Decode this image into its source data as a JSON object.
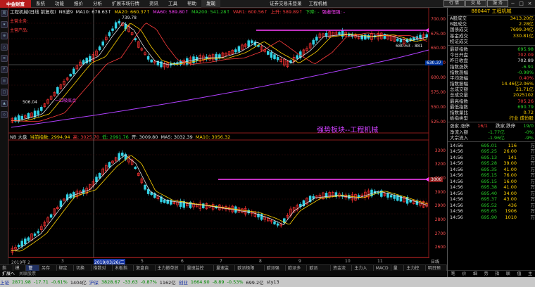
{
  "menubar": {
    "logo": "中金财富",
    "items": [
      "系统",
      "功能",
      "报价",
      "分析",
      "扩展市场行情",
      "资讯",
      "工具",
      "帮助",
      "发现"
    ],
    "active_index": 8,
    "center_items": [
      "证券交易未登录",
      "工程机械"
    ],
    "buttons": [
      "行 情",
      "交 易",
      "服 务"
    ],
    "win_symbols": [
      "−",
      "□",
      "×"
    ]
  },
  "left_tools": [
    "周",
    "★",
    "⊕",
    "△",
    "≡",
    "F",
    "◎",
    "□",
    "▲",
    "◇"
  ],
  "upper_chart": {
    "legend": [
      {
        "text": "工程机械(日线 前复权)",
        "color": "#e0e0e0"
      },
      {
        "text": "NB波9",
        "color": "#e0e0e0"
      },
      {
        "text": "MA10: 678.63↑",
        "color": "#e0e0e0"
      },
      {
        "text": "MA20: 660.37↑",
        "color": "#ffd200"
      },
      {
        "text": "MA60: 589.80↑",
        "color": "#ff40ff"
      },
      {
        "text": "MA200: 541.28↑",
        "color": "#28d028"
      },
      {
        "text": "VAR1: 600.56↑",
        "color": "#ff3c3c"
      },
      {
        "text": "上升: 589.89↑",
        "color": "#ff3c3c"
      },
      {
        "text": "下降: -",
        "color": "#28d028"
      },
      {
        "text": "强者恒强: -",
        "color": "#ff40ff"
      }
    ],
    "tag_main_business": "主营业务:",
    "tag_main_product": "主营产品:",
    "peak_label": "739.78",
    "low_label": "506.04",
    "entry_label": "一口吸底点",
    "right_range_label": "680.63 - 881",
    "strong_label": "强势板块--工程机械",
    "cursor_price": "630.37",
    "price_axis": [
      "700.00",
      "675.00",
      "650.00",
      "625.00",
      "600.00",
      "575.00",
      "550.00",
      "525.00"
    ]
  },
  "lower_chart": {
    "legend": [
      {
        "text": "NB 大盘",
        "color": "#e0e0e0"
      },
      {
        "text": "当前指数: 2994.94",
        "color": "#ffd200"
      },
      {
        "text": "高: 3025.70",
        "color": "#ff3c3c"
      },
      {
        "text": "低: 2991.76",
        "color": "#28d028"
      },
      {
        "text": "开: 3009.80",
        "color": "#e0e0e0"
      },
      {
        "text": "MA5: 3032.39",
        "color": "#e0e0e0"
      },
      {
        "text": "MA10: 3056.32",
        "color": "#ffd200"
      }
    ],
    "price_axis": [
      "3300",
      "3200",
      "3100",
      "3000",
      "2900",
      "2800",
      "2700",
      "2600"
    ],
    "cursor_price": "3000"
  },
  "date_axis": {
    "labels": [
      "2019年 2",
      "3",
      "2019/03/26/二",
      "5",
      "6",
      "7",
      "8",
      "9",
      "10",
      "11"
    ],
    "highlight_index": 2,
    "right_label": "日线"
  },
  "bottom_tabs": {
    "items": [
      "指标",
      "模板",
      "管理",
      "另存为",
      "绑定到",
      "切换到",
      "指数对比",
      "木板指标",
      "复盘自动",
      "主力撤单放量",
      "量速监控610",
      "量速监控",
      "欧派极限410",
      "欧派强势",
      "欧派多空",
      "欧派2503",
      "资金流向",
      "主力入场",
      "MACD",
      "量能",
      "主力控盘",
      "明日预测"
    ],
    "active_index": 2
  },
  "sub_tabs": {
    "items": [
      "扩展へ",
      "关联股票"
    ],
    "active_index": 0
  },
  "statusbar": {
    "items": [
      {
        "text": "上证",
        "cls": "st-blue"
      },
      {
        "text": "2871.98",
        "cls": "st-green"
      },
      {
        "text": "-17.71",
        "cls": "st-green"
      },
      {
        "text": "-0.61%",
        "cls": "st-green"
      },
      {
        "text": "1404亿",
        "cls": ""
      },
      {
        "text": "沪深",
        "cls": "st-blue"
      },
      {
        "text": "3828.67",
        "cls": "st-green"
      },
      {
        "text": "-33.63",
        "cls": "st-green"
      },
      {
        "text": "-0.87%",
        "cls": "st-green"
      },
      {
        "text": "1162亿",
        "cls": ""
      },
      {
        "text": "创业",
        "cls": "st-blue"
      },
      {
        "text": "1664.90",
        "cls": "st-green"
      },
      {
        "text": "-8.89",
        "cls": "st-green"
      },
      {
        "text": "-0.53%",
        "cls": "st-green"
      },
      {
        "text": "699.2亿",
        "cls": ""
      },
      {
        "text": "sty13",
        "cls": ""
      }
    ]
  },
  "right_panel": {
    "title": "880447 工程机械",
    "rows_top": [
      {
        "k": "A股成交",
        "v": "3413.20亿",
        "c": "#ffd000"
      },
      {
        "k": "B股成交",
        "v": "2.28亿",
        "c": "#ffd000"
      },
      {
        "k": "国债成交",
        "v": "7699.34亿",
        "c": "#ffd000"
      },
      {
        "k": "基金成交",
        "v": "330.81亿",
        "c": "#ffd000"
      },
      {
        "k": "权证成交",
        "v": "",
        "c": "#ffd000"
      }
    ],
    "rows_mid": [
      {
        "k": "最新指数",
        "v": "695.98",
        "c": "#28d028"
      },
      {
        "k": "今日开盘",
        "v": "702.09",
        "c": "#ff3c3c"
      },
      {
        "k": "昨日收盘",
        "v": "702.89",
        "c": "#e0e0e0"
      },
      {
        "k": "指数涨跌",
        "v": "-6.91",
        "c": "#28d028"
      },
      {
        "k": "指数涨幅",
        "v": "-0.98%",
        "c": "#28d028"
      },
      {
        "k": "平均涨幅",
        "v": "0.40%",
        "c": "#ff3c3c"
      },
      {
        "k": "指数振幅",
        "v": "14.46亿2.06%",
        "c": "#ffd000"
      },
      {
        "k": "总成交额",
        "v": "21.71亿",
        "c": "#ffd000"
      },
      {
        "k": "总成交量",
        "v": "2025102",
        "c": "#ffd000"
      },
      {
        "k": "最高指数",
        "v": "705.26",
        "c": "#ff3c3c"
      },
      {
        "k": "最低指数",
        "v": "690.79",
        "c": "#28d028"
      },
      {
        "k": "指数量比",
        "v": "0.72",
        "c": "#ffd000"
      },
      {
        "k": "板指类型",
        "v": "行业 成份股",
        "c": "#ffd000"
      }
    ],
    "updown": {
      "k": "涨家.涨停",
      "v1": "16/1",
      "k2": "跌家.跌停",
      "v2": "19/0"
    },
    "flows": [
      {
        "k": "净流入额",
        "v": "-1.77亿",
        "v2": "-0%",
        "c": "#28d028"
      },
      {
        "k": "大宗流入",
        "v": "-1.96亿",
        "v2": "-9%",
        "c": "#28d028"
      }
    ],
    "ticks": [
      {
        "t": "14:56",
        "p": "695.01",
        "v": "116",
        "f": "万"
      },
      {
        "t": "14:56",
        "p": "695.25",
        "v": "26.00",
        "f": "万"
      },
      {
        "t": "14:56",
        "p": "695.13",
        "v": "141",
        "f": "万"
      },
      {
        "t": "14:56",
        "p": "695.28",
        "v": "39.00",
        "f": "万"
      },
      {
        "t": "14:56",
        "p": "695.35",
        "v": "41.00",
        "f": "万"
      },
      {
        "t": "14:56",
        "p": "695.15",
        "v": "76.00",
        "f": "万"
      },
      {
        "t": "14:56",
        "p": "695.15",
        "v": "16.00",
        "f": "万"
      },
      {
        "t": "14:56",
        "p": "695.38",
        "v": "41.00",
        "f": "万"
      },
      {
        "t": "14:56",
        "p": "695.40",
        "v": "34.00",
        "f": "万"
      },
      {
        "t": "14:56",
        "p": "695.37",
        "v": "43.00",
        "f": "万"
      },
      {
        "t": "14:56",
        "p": "695.52",
        "v": "436",
        "f": "万"
      },
      {
        "t": "14:56",
        "p": "695.65",
        "v": "1906",
        "f": "万"
      },
      {
        "t": "14:56",
        "p": "695.90",
        "v": "1010",
        "f": "万"
      }
    ],
    "bottom_buttons": [
      "笔",
      "价",
      "细",
      "势",
      "指",
      "联",
      "值",
      "主"
    ]
  }
}
